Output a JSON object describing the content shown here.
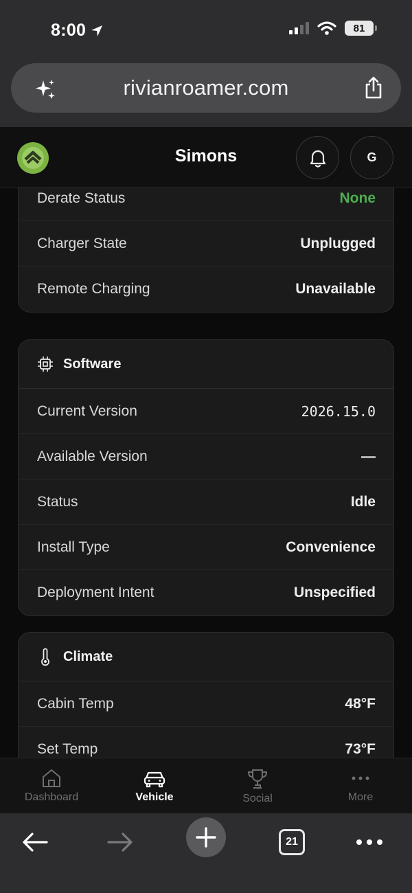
{
  "status_bar": {
    "time": "8:00",
    "battery": "81"
  },
  "browser": {
    "url": "rivianroamer.com"
  },
  "header": {
    "title": "Simons",
    "avatar_initial": "G"
  },
  "charging_card": {
    "rows": [
      {
        "label": "Derate Status",
        "value": "None",
        "value_color": "#4caf50"
      },
      {
        "label": "Charger State",
        "value": "Unplugged"
      },
      {
        "label": "Remote Charging",
        "value": "Unavailable"
      }
    ]
  },
  "software_card": {
    "title": "Software",
    "icon": "chip-icon",
    "rows": [
      {
        "label": "Current Version",
        "value": "2026.15.0"
      },
      {
        "label": "Available Version",
        "value": "—"
      },
      {
        "label": "Status",
        "value": "Idle"
      },
      {
        "label": "Install Type",
        "value": "Convenience"
      },
      {
        "label": "Deployment Intent",
        "value": "Unspecified"
      }
    ]
  },
  "climate_card": {
    "title": "Climate",
    "icon": "thermometer-icon",
    "rows": [
      {
        "label": "Cabin Temp",
        "value": "48°F"
      },
      {
        "label": "Set Temp",
        "value": "73°F"
      }
    ]
  },
  "tab_bar": {
    "tabs": [
      {
        "label": "Dashboard",
        "icon": "home-icon"
      },
      {
        "label": "Vehicle",
        "icon": "car-icon",
        "active": true
      },
      {
        "label": "Social",
        "icon": "trophy-icon"
      },
      {
        "label": "More",
        "icon": "more-icon"
      }
    ]
  },
  "toolbar": {
    "tab_count": "21"
  },
  "colors": {
    "accent_green": "#4caf50",
    "logo_green": "#7cb342",
    "background": "#0b0b0b",
    "card": "#1b1b1b"
  }
}
